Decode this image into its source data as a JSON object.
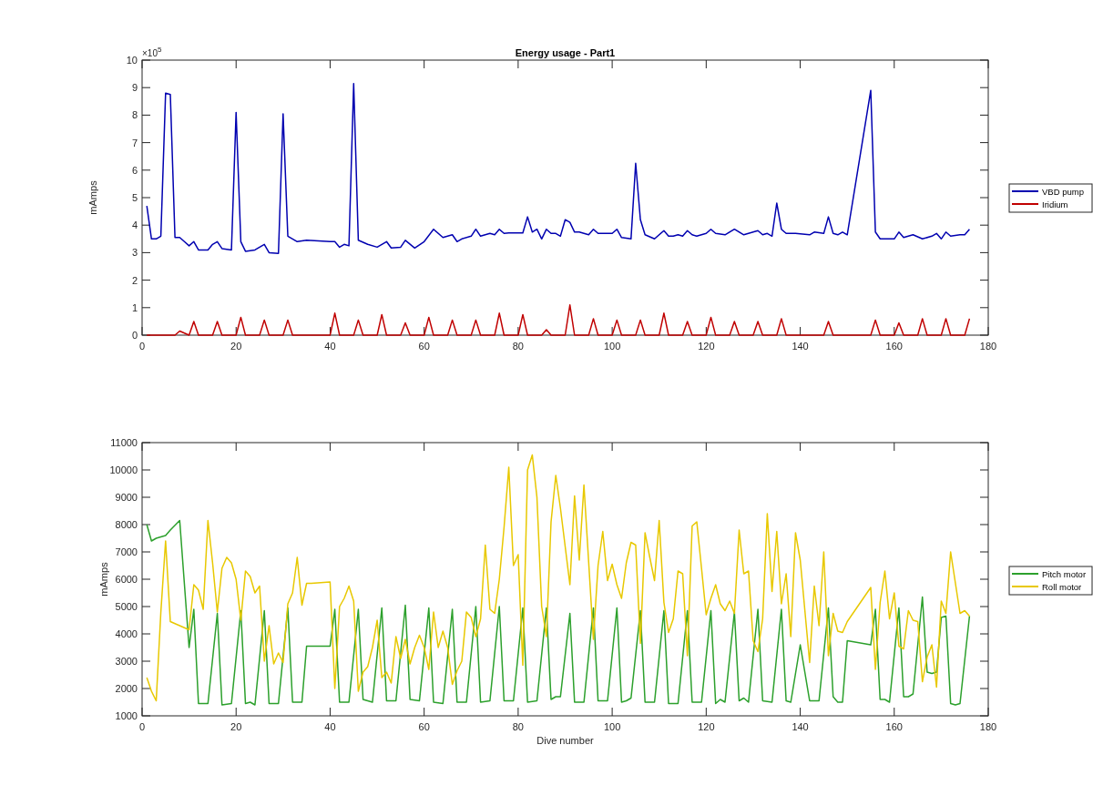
{
  "charts": [
    {
      "chart_data": {
        "type": "line",
        "legend": true,
        "title": "Energy usage - Part1",
        "ylabel": "mAmps",
        "xlim": [
          0,
          180
        ],
        "ylim": [
          0,
          10
        ],
        "xticks": [
          0,
          20,
          40,
          60,
          80,
          100,
          120,
          140,
          160,
          180
        ],
        "yticks": [
          0,
          1,
          2,
          3,
          4,
          5,
          6,
          7,
          8,
          9,
          10
        ],
        "series": [
          {
            "name": "VBD pump",
            "color": "#0000b0",
            "x": [
              1,
              2,
              3,
              4,
              5,
              6,
              7,
              8,
              9,
              10,
              11,
              12,
              14,
              15,
              16,
              17,
              19,
              20,
              21,
              22,
              24,
              26,
              27,
              29,
              30,
              31,
              33,
              35,
              40,
              41,
              42,
              43,
              44,
              45,
              46,
              48,
              50,
              52,
              53,
              55,
              56,
              58,
              60,
              62,
              64,
              66,
              67,
              68,
              70,
              71,
              72,
              74,
              75,
              76,
              77,
              78,
              81,
              82,
              83,
              84,
              85,
              86,
              87,
              88,
              89,
              90,
              91,
              92,
              93,
              94,
              95,
              96,
              97,
              98,
              100,
              101,
              102,
              104,
              105,
              106,
              107,
              109,
              111,
              112,
              113,
              114,
              115,
              116,
              117,
              118,
              120,
              121,
              122,
              124,
              126,
              128,
              130,
              131,
              132,
              133,
              134,
              135,
              136,
              137,
              139,
              142,
              143,
              145,
              146,
              147,
              148,
              149,
              150,
              155,
              156,
              157,
              158,
              160,
              161,
              162,
              164,
              166,
              168,
              169,
              170,
              171,
              172,
              174,
              175,
              176
            ],
            "values": [
              4.7,
              3.5,
              3.5,
              3.6,
              8.8,
              8.75,
              3.55,
              3.55,
              3.4,
              3.25,
              3.4,
              3.1,
              3.1,
              3.3,
              3.4,
              3.15,
              3.1,
              8.1,
              3.4,
              3.05,
              3.1,
              3.3,
              3.0,
              2.97,
              8.05,
              3.6,
              3.4,
              3.45,
              3.4,
              3.4,
              3.2,
              3.3,
              3.25,
              9.15,
              3.45,
              3.3,
              3.2,
              3.4,
              3.17,
              3.2,
              3.45,
              3.17,
              3.4,
              3.85,
              3.55,
              3.65,
              3.4,
              3.5,
              3.6,
              3.85,
              3.6,
              3.7,
              3.65,
              3.85,
              3.7,
              3.72,
              3.72,
              4.3,
              3.75,
              3.85,
              3.5,
              3.85,
              3.7,
              3.7,
              3.6,
              4.2,
              4.1,
              3.75,
              3.75,
              3.7,
              3.65,
              3.85,
              3.7,
              3.7,
              3.7,
              3.85,
              3.55,
              3.5,
              6.25,
              4.2,
              3.65,
              3.5,
              3.8,
              3.6,
              3.6,
              3.65,
              3.6,
              3.8,
              3.65,
              3.6,
              3.7,
              3.85,
              3.7,
              3.65,
              3.85,
              3.65,
              3.75,
              3.8,
              3.65,
              3.7,
              3.6,
              4.8,
              3.85,
              3.7,
              3.7,
              3.65,
              3.75,
              3.7,
              4.3,
              3.7,
              3.65,
              3.75,
              3.65,
              8.9,
              3.75,
              3.5,
              3.5,
              3.5,
              3.75,
              3.55,
              3.65,
              3.5,
              3.6,
              3.7,
              3.5,
              3.75,
              3.6,
              3.65,
              3.65,
              3.85
            ]
          },
          {
            "name": "Iridium",
            "color": "#c00000",
            "x": [
              1,
              7,
              8,
              10,
              11,
              12,
              15,
              16,
              17,
              20,
              21,
              22,
              25,
              26,
              27,
              30,
              31,
              32,
              40,
              41,
              42,
              45,
              46,
              47,
              50,
              51,
              52,
              55,
              56,
              57,
              60,
              61,
              62,
              65,
              66,
              67,
              70,
              71,
              72,
              75,
              76,
              77,
              80,
              81,
              82,
              85,
              86,
              87,
              90,
              91,
              92,
              95,
              96,
              97,
              100,
              101,
              102,
              105,
              106,
              107,
              110,
              111,
              112,
              115,
              116,
              117,
              120,
              121,
              122,
              125,
              126,
              127,
              130,
              131,
              132,
              135,
              136,
              137,
              145,
              146,
              147,
              155,
              156,
              157,
              160,
              161,
              162,
              165,
              166,
              167,
              170,
              171,
              172,
              175,
              176
            ],
            "values": [
              0,
              0,
              0.15,
              0,
              0.5,
              0,
              0,
              0.5,
              0,
              0,
              0.65,
              0,
              0,
              0.55,
              0,
              0,
              0.55,
              0,
              0,
              0.8,
              0,
              0,
              0.55,
              0,
              0,
              0.75,
              0,
              0,
              0.45,
              0,
              0,
              0.65,
              0,
              0,
              0.55,
              0,
              0,
              0.55,
              0,
              0,
              0.8,
              0,
              0,
              0.75,
              0,
              0,
              0.2,
              0,
              0,
              1.1,
              0,
              0,
              0.6,
              0,
              0,
              0.55,
              0,
              0,
              0.55,
              0,
              0,
              0.8,
              0,
              0,
              0.5,
              0,
              0,
              0.65,
              0,
              0,
              0.5,
              0,
              0,
              0.5,
              0,
              0,
              0.6,
              0,
              0,
              0.5,
              0,
              0,
              0.55,
              0,
              0,
              0.45,
              0,
              0,
              0.6,
              0,
              0,
              0.6,
              0,
              0,
              0.6
            ]
          }
        ]
      },
      "exponent": {
        "base": "×10",
        "power": "5"
      }
    },
    {
      "chart_data": {
        "type": "line",
        "legend": true,
        "xlabel": "Dive number",
        "ylabel": "mAmps",
        "xlim": [
          0,
          180
        ],
        "ylim": [
          1000,
          11000
        ],
        "xticks": [
          0,
          20,
          40,
          60,
          80,
          100,
          120,
          140,
          160,
          180
        ],
        "yticks": [
          1000,
          2000,
          3000,
          4000,
          5000,
          6000,
          7000,
          8000,
          9000,
          10000,
          11000
        ],
        "series": [
          {
            "name": "Pitch motor",
            "color": "#2ca02c",
            "x": [
              1,
              2,
              3,
              5,
              6,
              8,
              10,
              11,
              12,
              14,
              16,
              17,
              19,
              21,
              22,
              23,
              24,
              26,
              27,
              29,
              31,
              32,
              34,
              35,
              40,
              41,
              42,
              44,
              46,
              47,
              49,
              51,
              52,
              54,
              56,
              57,
              59,
              61,
              62,
              64,
              66,
              67,
              69,
              71,
              72,
              74,
              76,
              77,
              79,
              81,
              82,
              84,
              86,
              87,
              88,
              89,
              91,
              92,
              94,
              96,
              97,
              99,
              101,
              102,
              103,
              104,
              106,
              107,
              109,
              111,
              112,
              114,
              116,
              117,
              119,
              121,
              122,
              123,
              124,
              126,
              127,
              128,
              129,
              131,
              132,
              134,
              136,
              137,
              138,
              140,
              142,
              144,
              146,
              147,
              148,
              149,
              150,
              155,
              156,
              157,
              158,
              159,
              161,
              162,
              163,
              164,
              166,
              167,
              168,
              169,
              170,
              171,
              172,
              173,
              174,
              176
            ],
            "values": [
              8000,
              7400,
              7500,
              7600,
              7800,
              8150,
              3500,
              4900,
              1450,
              1450,
              4750,
              1400,
              1450,
              4850,
              1450,
              1500,
              1400,
              4850,
              1450,
              1450,
              4950,
              1500,
              1500,
              3550,
              3550,
              4900,
              1500,
              1500,
              4900,
              1600,
              1500,
              4950,
              1550,
              1550,
              5050,
              1600,
              1550,
              4950,
              1500,
              1450,
              4900,
              1500,
              1500,
              5000,
              1500,
              1550,
              5000,
              1550,
              1550,
              4950,
              1500,
              1550,
              4950,
              1600,
              1700,
              1700,
              4750,
              1500,
              1500,
              4950,
              1550,
              1550,
              4950,
              1500,
              1550,
              1650,
              4850,
              1500,
              1500,
              4850,
              1450,
              1450,
              4850,
              1500,
              1500,
              4850,
              1450,
              1600,
              1500,
              4800,
              1550,
              1650,
              1500,
              4900,
              1550,
              1500,
              4900,
              1550,
              1500,
              3600,
              1550,
              1550,
              4950,
              1700,
              1500,
              1500,
              3750,
              3600,
              4900,
              1600,
              1600,
              1500,
              4950,
              1700,
              1700,
              1800,
              5350,
              2600,
              2550,
              2600,
              4600,
              4650,
              1450,
              1400,
              1450,
              4650
            ]
          },
          {
            "name": "Roll motor",
            "color": "#e8c800",
            "x": [
              1,
              2,
              3,
              4,
              5,
              6,
              10,
              11,
              12,
              13,
              14,
              15,
              16,
              17,
              18,
              19,
              20,
              21,
              22,
              23,
              24,
              25,
              26,
              27,
              28,
              29,
              30,
              31,
              32,
              33,
              34,
              35,
              36,
              40,
              41,
              42,
              43,
              44,
              45,
              46,
              47,
              48,
              49,
              50,
              51,
              52,
              53,
              54,
              55,
              56,
              57,
              58,
              59,
              60,
              61,
              62,
              63,
              64,
              65,
              66,
              67,
              68,
              69,
              70,
              71,
              72,
              73,
              74,
              75,
              76,
              77,
              78,
              79,
              80,
              81,
              82,
              83,
              84,
              85,
              86,
              87,
              88,
              89,
              91,
              92,
              93,
              94,
              96,
              97,
              98,
              99,
              100,
              101,
              102,
              103,
              104,
              105,
              106,
              107,
              108,
              109,
              110,
              111,
              112,
              113,
              114,
              115,
              116,
              117,
              118,
              119,
              120,
              121,
              122,
              123,
              124,
              125,
              126,
              127,
              128,
              129,
              130,
              131,
              132,
              133,
              134,
              135,
              136,
              137,
              138,
              139,
              140,
              142,
              143,
              144,
              145,
              146,
              147,
              148,
              149,
              150,
              155,
              156,
              157,
              158,
              159,
              160,
              161,
              162,
              163,
              164,
              165,
              166,
              167,
              168,
              169,
              170,
              171,
              172,
              174,
              175,
              176
            ],
            "values": [
              2400,
              1900,
              1550,
              4800,
              7400,
              4450,
              4150,
              5800,
              5600,
              4900,
              8150,
              6600,
              4800,
              6400,
              6800,
              6600,
              6000,
              4500,
              6300,
              6100,
              5500,
              5750,
              3000,
              4300,
              2900,
              3300,
              2950,
              5100,
              5500,
              6800,
              5050,
              5850,
              5850,
              5900,
              2000,
              5000,
              5300,
              5750,
              5200,
              1900,
              2600,
              2800,
              3500,
              4500,
              2400,
              2600,
              2200,
              3900,
              3100,
              3800,
              2900,
              3500,
              3950,
              3500,
              2700,
              4800,
              3500,
              4100,
              3500,
              2150,
              2650,
              3000,
              4800,
              4600,
              3900,
              4550,
              7250,
              4900,
              4750,
              6000,
              7900,
              10100,
              6500,
              6900,
              2850,
              10000,
              10550,
              9000,
              5000,
              3900,
              8100,
              9800,
              8600,
              5800,
              9050,
              6700,
              9450,
              3800,
              6500,
              7750,
              5950,
              6550,
              5800,
              5300,
              6600,
              7350,
              7250,
              3650,
              7700,
              6800,
              5950,
              8150,
              5150,
              4050,
              4550,
              6300,
              6200,
              3200,
              7950,
              8100,
              6400,
              4700,
              5300,
              5800,
              5100,
              4850,
              5200,
              4750,
              7800,
              6200,
              6300,
              3750,
              3350,
              4550,
              8400,
              5550,
              7750,
              5100,
              6200,
              3900,
              7700,
              6700,
              2950,
              5750,
              4300,
              7000,
              3200,
              4750,
              4100,
              4050,
              4450,
              5700,
              2700,
              5150,
              6300,
              4550,
              5500,
              3550,
              3450,
              4850,
              4500,
              4450,
              2250,
              3150,
              3600,
              2050,
              5200,
              4750,
              7000,
              4750,
              4850,
              4650
            ]
          }
        ]
      }
    }
  ]
}
